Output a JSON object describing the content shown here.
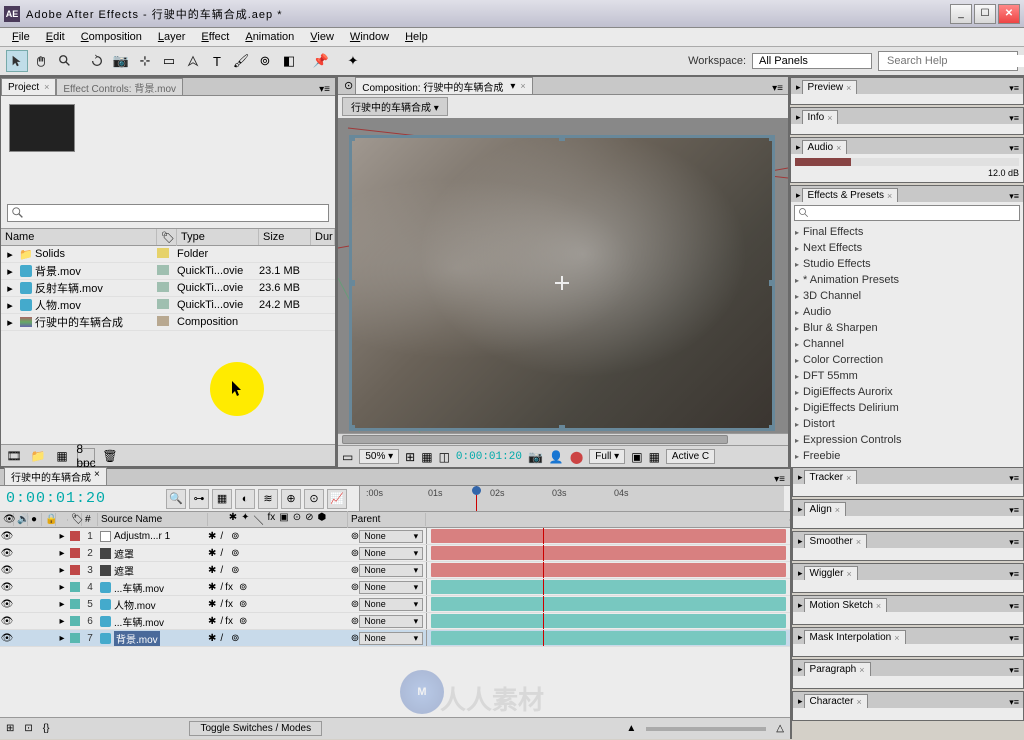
{
  "title": "Adobe After Effects - 行驶中的车辆合成.aep *",
  "menu": [
    "File",
    "Edit",
    "Composition",
    "Layer",
    "Effect",
    "Animation",
    "View",
    "Window",
    "Help"
  ],
  "toolbar": {
    "workspace_label": "Workspace:",
    "workspace_value": "All Panels",
    "search_placeholder": "Search Help"
  },
  "project": {
    "tab": "Project",
    "tab2": "Effect Controls: 背景.mov",
    "cols": {
      "name": "Name",
      "type": "Type",
      "size": "Size",
      "dur": "Dur"
    },
    "rows": [
      {
        "icon": "folder",
        "name": "Solids",
        "tag": "#e6d26a",
        "type": "Folder",
        "size": "",
        "dur": ""
      },
      {
        "icon": "mov",
        "name": "背景.mov",
        "tag": "#9fbfb0",
        "type": "QuickTi...ovie",
        "size": "23.1 MB",
        "dur": ""
      },
      {
        "icon": "mov",
        "name": "反射车辆.mov",
        "tag": "#9fbfb0",
        "type": "QuickTi...ovie",
        "size": "23.6 MB",
        "dur": ""
      },
      {
        "icon": "mov",
        "name": "人物.mov",
        "tag": "#9fbfb0",
        "type": "QuickTi...ovie",
        "size": "24.2 MB",
        "dur": ""
      },
      {
        "icon": "comp",
        "name": "行驶中的车辆合成",
        "tag": "#b8a890",
        "type": "Composition",
        "size": "",
        "dur": ""
      }
    ],
    "bpc": "8 bpc"
  },
  "comp": {
    "tab": "Composition: 行驶中的车辆合成",
    "flowchart": "行驶中的车辆合成",
    "zoom": "50%",
    "timecode": "0:00:01:20",
    "quality": "Full",
    "activecam": "Active C"
  },
  "right_panels": [
    "Preview",
    "Info",
    "Audio"
  ],
  "audio_db": "12.0 dB",
  "effects": {
    "tab": "Effects & Presets",
    "cats": [
      "Final Effects",
      "Next Effects",
      "Studio Effects",
      "* Animation Presets",
      "3D Channel",
      "Audio",
      "Blur & Sharpen",
      "Channel",
      "Color Correction",
      "DFT 55mm",
      "DigiEffects Aurorix",
      "DigiEffects Delirium",
      "Distort",
      "Expression Controls",
      "Freebie"
    ]
  },
  "right_panels2": [
    "Tracker",
    "Align",
    "Smoother",
    "Wiggler",
    "Motion Sketch",
    "Mask Interpolation",
    "Paragraph",
    "Character"
  ],
  "timeline": {
    "tab": "行驶中的车辆合成",
    "timecode": "0:00:01:20",
    "ruler": [
      ":00s",
      "01s",
      "02s",
      "03s",
      "04s"
    ],
    "hdr_source": "Source Name",
    "hdr_parent": "Parent",
    "none": "None",
    "layers": [
      {
        "num": "1",
        "label": "#c04848",
        "icon": "adj",
        "name": "Adjustm...r 1",
        "fx": false,
        "parent": "None",
        "color": "#d88080",
        "sel": false
      },
      {
        "num": "2",
        "label": "#c04848",
        "icon": "solid",
        "name": "遮罩",
        "fx": false,
        "parent": "None",
        "color": "#d88080",
        "sel": false
      },
      {
        "num": "3",
        "label": "#c04848",
        "icon": "solid",
        "name": "遮罩",
        "fx": false,
        "parent": "None",
        "color": "#d88080",
        "sel": false
      },
      {
        "num": "4",
        "label": "#58b8b0",
        "icon": "mov",
        "name": "...车辆.mov",
        "fx": true,
        "parent": "None",
        "color": "#78c8c0",
        "sel": false
      },
      {
        "num": "5",
        "label": "#58b8b0",
        "icon": "mov",
        "name": "人物.mov",
        "fx": true,
        "parent": "None",
        "color": "#78c8c0",
        "sel": false
      },
      {
        "num": "6",
        "label": "#58b8b0",
        "icon": "mov",
        "name": "...车辆.mov",
        "fx": true,
        "parent": "None",
        "color": "#78c8c0",
        "sel": false
      },
      {
        "num": "7",
        "label": "#58b8b0",
        "icon": "mov",
        "name": "背景.mov",
        "fx": false,
        "parent": "None",
        "color": "#78c8c0",
        "sel": true
      }
    ],
    "footer_toggle": "Toggle Switches / Modes"
  }
}
